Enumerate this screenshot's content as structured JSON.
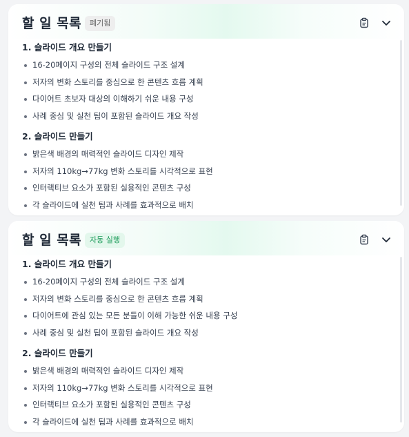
{
  "cards": [
    {
      "title": "할 일 목록",
      "badge": "폐기됨",
      "sections": [
        {
          "heading": "1. 슬라이드 개요 만들기",
          "items": [
            "16-20페이지 구성의 전체 슬라이드 구조 설계",
            "저자의 변화 스토리를 중심으로 한 콘텐츠 흐름 계획",
            "다이어트 초보자 대상의 이해하기 쉬운 내용 구성",
            "사례 중심 및 실천 팁이 포함된 슬라이드 개요 작성"
          ]
        },
        {
          "heading": "2. 슬라이드 만들기",
          "items": [
            "밝은색 배경의 매력적인 슬라이드 디자인 제작",
            "저자의 110kg→77kg 변화 스토리를 시각적으로 표현",
            "인터랙티브 요소가 포함된 실용적인 콘텐츠 구성",
            "각 슬라이드에 실천 팁과 사례를 효과적으로 배치"
          ]
        }
      ]
    },
    {
      "title": "할 일 목록",
      "badge": "자동 실행",
      "sections": [
        {
          "heading": "1. 슬라이드 개요 만들기",
          "items": [
            "16-20페이지 구성의 전체 슬라이드 구조 설계",
            "저자의 변화 스토리를 중심으로 한 콘텐츠 흐름 계획",
            "다이어트에 관심 있는 모든 분들이 이해 가능한 쉬운 내용 구성",
            "사례 중심 및 실천 팁이 포함된 슬라이드 개요 작성"
          ]
        },
        {
          "heading": "2. 슬라이드 만들기",
          "items": [
            "밝은색 배경의 매력적인 슬라이드 디자인 제작",
            "저자의 110kg→77kg 변화 스토리를 시각적으로 표현",
            "인터랙티브 요소가 포함된 실용적인 콘텐츠 구성",
            "각 슬라이드에 실천 팁과 사례를 효과적으로 배치"
          ]
        }
      ]
    }
  ],
  "icons": {
    "clipboard": "clipboard-icon",
    "chevron": "chevron-down-icon"
  },
  "colors": {
    "badge_deprecated_bg": "#eeeeee",
    "badge_auto_bg": "#e3f7ec",
    "badge_auto_text": "#1f9d5c",
    "header_accent": "#e4f9ef"
  }
}
